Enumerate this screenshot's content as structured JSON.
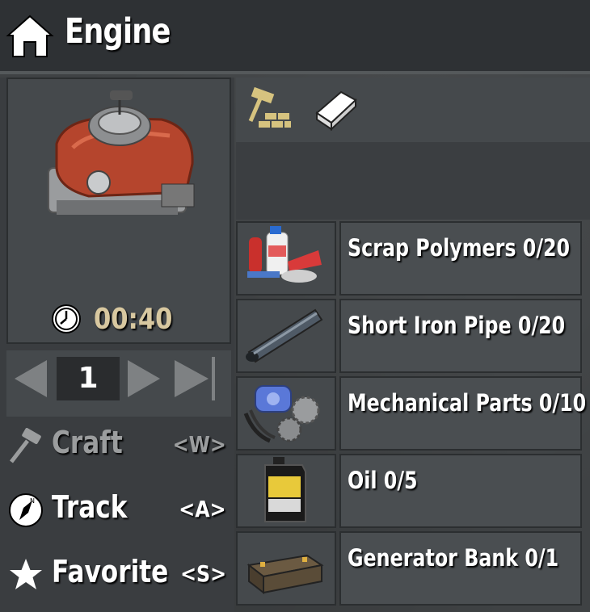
{
  "header": {
    "title": "Engine",
    "home_icon": "home-icon"
  },
  "recipe": {
    "craft_time": "00:40",
    "quantity": "1"
  },
  "actions": {
    "craft": {
      "label": "Craft",
      "key": "<W>",
      "icon": "hammer-icon",
      "enabled": false
    },
    "track": {
      "label": "Track",
      "key": "<A>",
      "icon": "compass-icon"
    },
    "favorite": {
      "label": "Favorite",
      "key": "<S>",
      "icon": "star-icon"
    }
  },
  "tabs": [
    {
      "icon": "crafting-station-icon"
    },
    {
      "icon": "recipe-book-icon"
    }
  ],
  "ingredients": [
    {
      "name": "Scrap Polymers 0/20",
      "icon": "scrap-polymers-icon"
    },
    {
      "name": "Short Iron Pipe 0/20",
      "icon": "iron-pipe-icon"
    },
    {
      "name": "Mechanical Parts 0/10",
      "icon": "mechanical-parts-icon"
    },
    {
      "name": "Oil 0/5",
      "icon": "oil-can-icon"
    },
    {
      "name": "Generator Bank 0/1",
      "icon": "generator-bank-icon"
    }
  ],
  "colors": {
    "timer": "#d8c8a0",
    "disabled": "#9b9d9e",
    "panel": "#45494c"
  }
}
